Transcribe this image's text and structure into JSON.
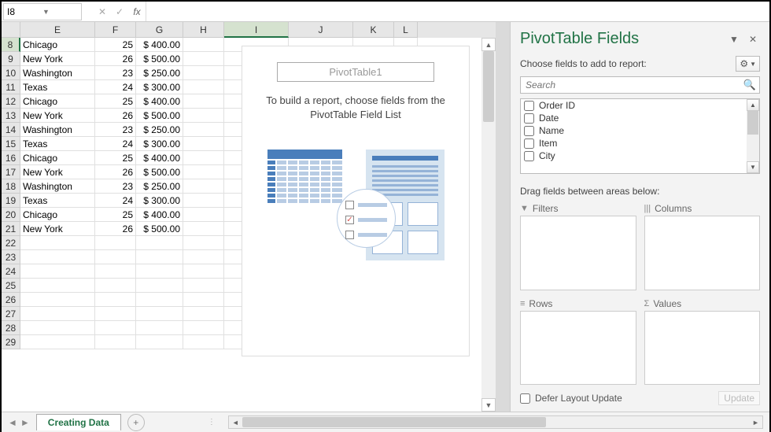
{
  "name_box": "I8",
  "columns": [
    "E",
    "F",
    "G",
    "H",
    "I",
    "J",
    "K",
    "L"
  ],
  "col_widths": [
    "col-E",
    "col-F",
    "col-G",
    "col-H",
    "col-I",
    "col-J",
    "col-K",
    "col-L"
  ],
  "active_col_index": 4,
  "first_row": 8,
  "data_rows": [
    [
      "Chicago",
      "25",
      "$ 400.00"
    ],
    [
      "New York",
      "26",
      "$ 500.00"
    ],
    [
      "Washington",
      "23",
      "$ 250.00"
    ],
    [
      "Texas",
      "24",
      "$ 300.00"
    ],
    [
      "Chicago",
      "25",
      "$ 400.00"
    ],
    [
      "New York",
      "26",
      "$ 500.00"
    ],
    [
      "Washington",
      "23",
      "$ 250.00"
    ],
    [
      "Texas",
      "24",
      "$ 300.00"
    ],
    [
      "Chicago",
      "25",
      "$ 400.00"
    ],
    [
      "New York",
      "26",
      "$ 500.00"
    ],
    [
      "Washington",
      "23",
      "$ 250.00"
    ],
    [
      "Texas",
      "24",
      "$ 300.00"
    ],
    [
      "Chicago",
      "25",
      "$ 400.00"
    ],
    [
      "New York",
      "26",
      "$ 500.00"
    ]
  ],
  "empty_row_count": 8,
  "pivot": {
    "title": "PivotTable1",
    "sub1": "To build a report, choose fields from the",
    "sub2": "PivotTable Field List"
  },
  "panel": {
    "title": "PivotTable Fields",
    "choose": "Choose fields to add to report:",
    "search_ph": "Search",
    "fields": [
      "Order ID",
      "Date",
      "Name",
      "Item",
      "City"
    ],
    "drag_label": "Drag fields between areas below:",
    "filters": "Filters",
    "columns": "Columns",
    "rows": "Rows",
    "values": "Values",
    "defer": "Defer Layout Update",
    "update": "Update"
  },
  "sheet_tab": "Creating Data"
}
